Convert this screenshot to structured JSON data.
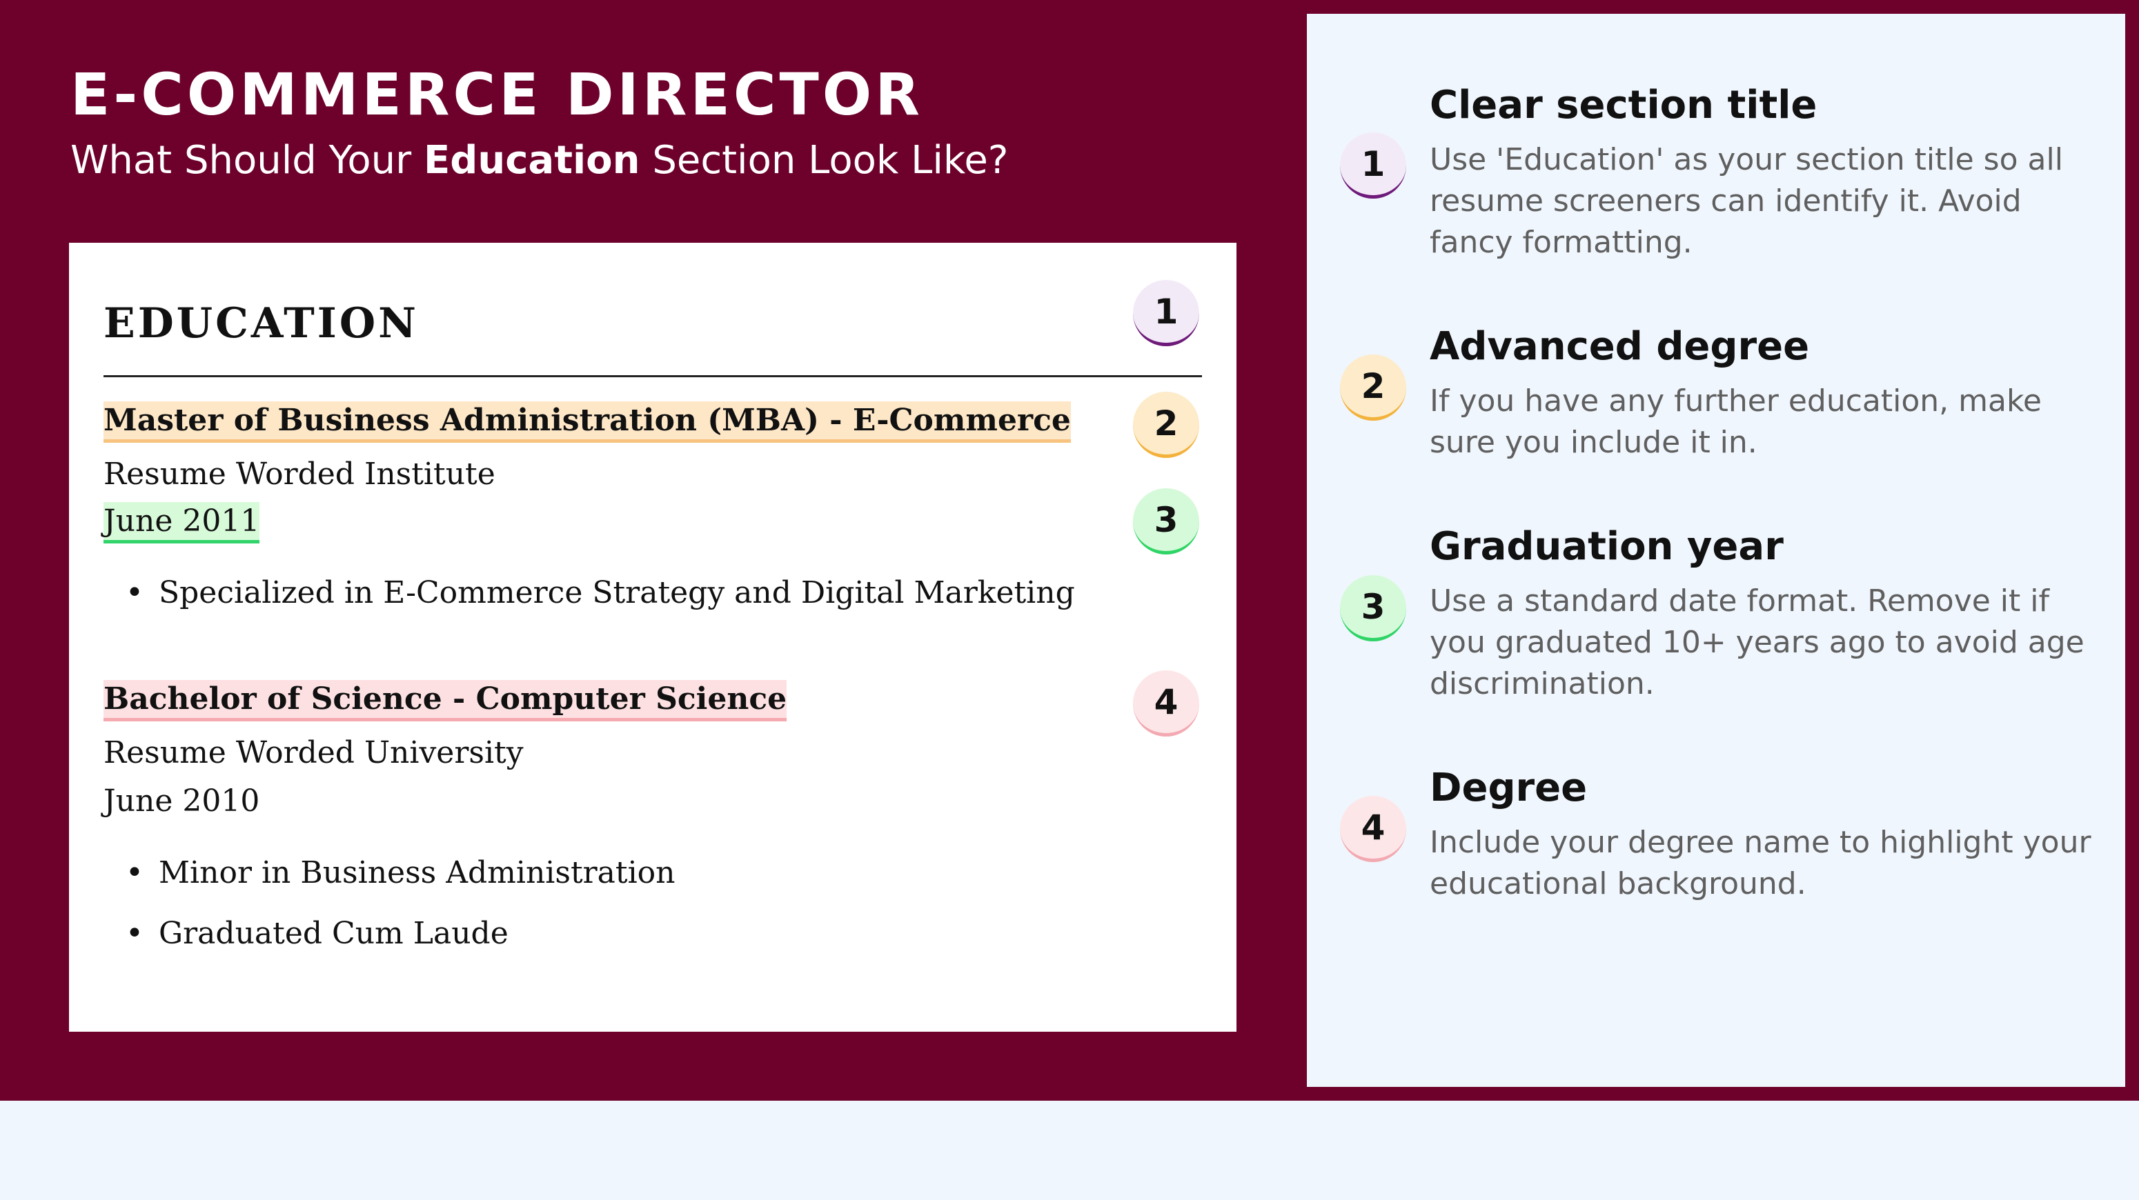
{
  "header": {
    "title": "E-COMMERCE DIRECTOR",
    "subtitle_prefix": "What Should Your",
    "subtitle_bold": "Education",
    "subtitle_suffix": "Section Look Like?"
  },
  "resume": {
    "section_heading": "EDUCATION",
    "entries": [
      {
        "degree": "Master of Business Administration (MBA) - E-Commerce",
        "school": "Resume Worded Institute",
        "date": "June 2011",
        "bullets": [
          "Specialized in E-Commerce Strategy and Digital Marketing"
        ]
      },
      {
        "degree": "Bachelor of Science - Computer Science",
        "school": "Resume Worded University",
        "date": "June 2010",
        "bullets": [
          "Minor in Business Administration",
          "Graduated Cum Laude"
        ]
      }
    ],
    "badges": [
      "1",
      "2",
      "3",
      "4"
    ]
  },
  "tips": [
    {
      "number": "1",
      "title": "Clear section title",
      "text": "Use 'Education' as your section title so all resume screeners can identify it. Avoid fancy formatting."
    },
    {
      "number": "2",
      "title": "Advanced degree",
      "text": "If you have any further education, make sure you include it in."
    },
    {
      "number": "3",
      "title": "Graduation year",
      "text": "Use a standard date format. Remove it if you graduated 10+ years ago to avoid age discrimination."
    },
    {
      "number": "4",
      "title": "Degree",
      "text": "Include your degree name to highlight your educational background."
    }
  ],
  "colors": {
    "brand_maroon": "#6d012b",
    "panel_background": "#f0f6fd",
    "badge_1_accent": "#6e1a7a",
    "badge_2_accent": "#f3b23b",
    "badge_3_accent": "#2fd466",
    "badge_4_accent": "#f3a9b1"
  }
}
